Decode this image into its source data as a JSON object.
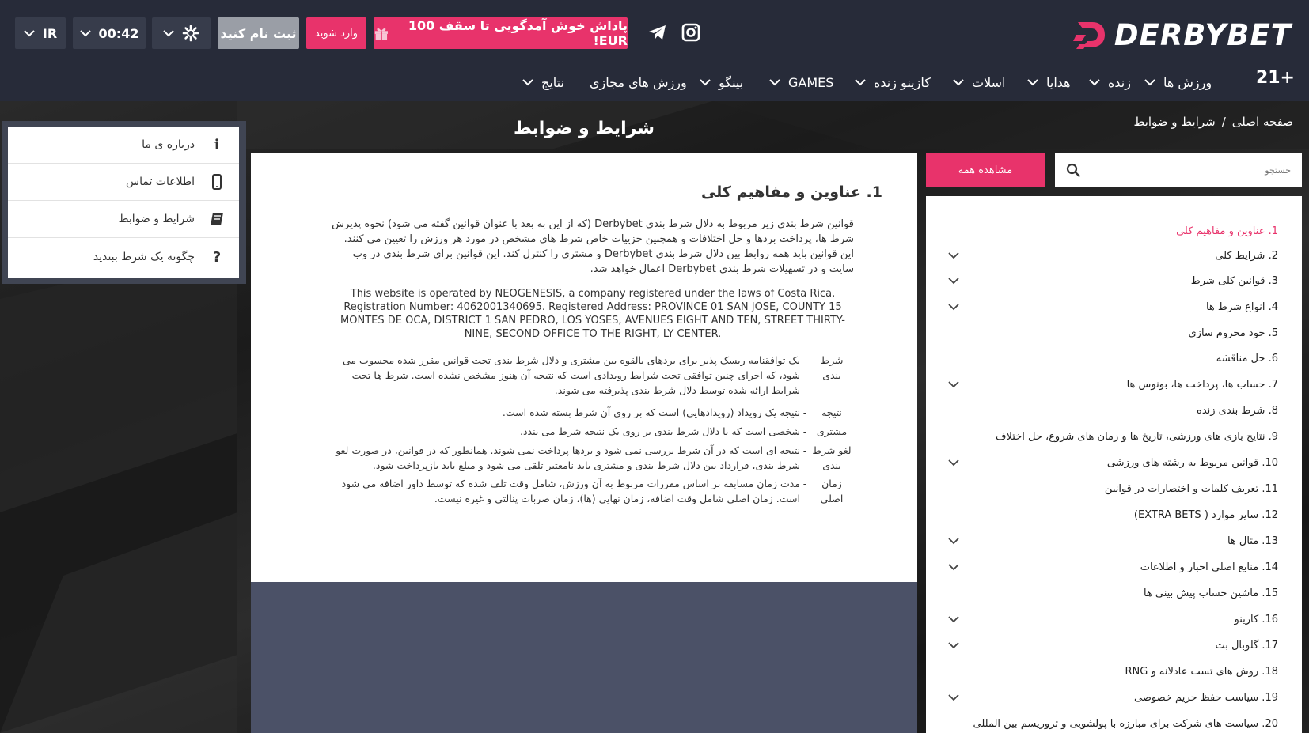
{
  "brand": {
    "name": "DERBYBET",
    "accent": "#e8336b",
    "header_bg": "#272b39"
  },
  "header": {
    "bonus_label": "پاداش خوش آمدگویی تا سقف 100 EUR!",
    "login_label": "وارد شوید",
    "register_label": "ثبت نام کنید",
    "time": "00:42",
    "language": "IR",
    "age_badge": "21+",
    "social_icons": [
      "instagram-icon",
      "telegram-icon"
    ]
  },
  "nav": {
    "items": [
      {
        "label": "ورزش ها"
      },
      {
        "label": "زنده"
      },
      {
        "label": "هدایا"
      },
      {
        "label": "اسلات"
      },
      {
        "label": "کازینو زنده"
      },
      {
        "label": "GAMES"
      },
      {
        "label": "بینگو"
      },
      {
        "label": "ورزش های مجازی"
      },
      {
        "label": "نتایج"
      }
    ]
  },
  "breadcrumb": {
    "home": "صفحه اصلی",
    "separator": "/",
    "current": "شرایط و ضوابط"
  },
  "page_title": "شرایط و ضوابط",
  "info_panel": {
    "items": [
      {
        "label": "درباره ی ما",
        "icon": "info-icon"
      },
      {
        "label": "اطلاعات تماس",
        "icon": "phone-icon"
      },
      {
        "label": "شرایط و ضوابط",
        "icon": "book-icon"
      },
      {
        "label": "چگونه یک شرط ببندید",
        "icon": "question-icon"
      }
    ]
  },
  "document": {
    "heading": "1. عناوین و مفاهیم کلی",
    "para1": "قوانین شرط بندی زیر مربوط به دلال شرط بندی Derbybet (که از این به بعد با عنوان قوانین گفته می شود) نحوه پذیرش شرط ها، پرداخت بردها و حل اختلافات و همچنین جزییات خاص شرط های مشخص در مورد هر ورزش را تعیین می کنند. این قوانین باید همه روابط بین دلال شرط بندی Derbybet و مشتری را کنترل کند. این قوانین برای شرط بندی در وب سایت و در تسهیلات شرط بندی Derbybet اعمال خواهد شد.",
    "para2": "This website is operated by NEOGENESIS, a company registered under the laws of Costa Rica. Registration Number: 4062001340695. Registered Address: PROVINCE 01 SAN JOSE, COUNTY 15 MONTES DE OCA, DISTRICT 1 SAN PEDRO, LOS YOSES, AVENUES EIGHT AND TEN, STREET THIRTY-NINE, SECOND OFFICE TO THE RIGHT, LY CENTER.",
    "definitions": [
      {
        "term": "شرط بندی",
        "text": "یک توافقنامه ریسک پذیر برای بردهای بالقوه بین مشتری و دلال شرط بندی تحت قوانین مقرر شده محسوب می شود، که اجرای چنین توافقی تحت شرایط رویدادی است که نتیجه آن هنوز مشخص نشده است. شرط ها تحت شرایط ارائه شده توسط دلال شرط بندی پذیرفته می شوند."
      },
      {
        "term": "نتیجه",
        "text": "نتیجه یک رویداد (رویدادهایی) است که بر روی آن شرط بسته شده است."
      },
      {
        "term": "مشتری",
        "text": "شخصی است که با دلال شرط بندی بر روی یک نتیجه شرط می بندد."
      },
      {
        "term": "لغو شرط بندی",
        "text": "نتیجه ای است که در آن شرط بررسی نمی شود و بردها پرداخت نمی شوند. همانطور که در قوانین، در صورت لغو شرط بندی، قرارداد بین دلال شرط بندی و مشتری باید نامعتبر تلقی می شود و مبلغ باید بازپرداخت شود."
      },
      {
        "term": "زمان اصلی",
        "text": "مدت زمان مسابقه بر اساس مقررات مربوط به آن ورزش، شامل وقت تلف شده که توسط داور اضافه می شود است. زمان اصلی شامل وقت اضافه، زمان نهایی (ها)، زمان ضربات پنالتی و غیره نیست."
      }
    ]
  },
  "sidebar": {
    "search_placeholder": "جستجو",
    "view_all_label": "مشاهده همه",
    "toc": [
      {
        "label": "1. عناوین و مفاهیم کلی",
        "active": true,
        "expandable": false
      },
      {
        "label": "2. شرایط کلی",
        "active": false,
        "expandable": true
      },
      {
        "label": "3. قوانین کلی شرط",
        "active": false,
        "expandable": true
      },
      {
        "label": "4. انواع شرط ها",
        "active": false,
        "expandable": true
      },
      {
        "label": "5. خود محروم سازی",
        "active": false,
        "expandable": false
      },
      {
        "label": "6. حل مناقشه",
        "active": false,
        "expandable": false
      },
      {
        "label": "7. حساب ها، پرداخت ها، بونوس ها",
        "active": false,
        "expandable": true
      },
      {
        "label": "8. شرط بندی زنده",
        "active": false,
        "expandable": false
      },
      {
        "label": "9. نتایج بازی های ورزشی، تاریخ ها و زمان های شروع، حل اختلاف",
        "active": false,
        "expandable": false
      },
      {
        "label": "10. قوانین مربوط به رشته های ورزشی",
        "active": false,
        "expandable": true
      },
      {
        "label": "11. تعریف کلمات و اختصارات در قوانین",
        "active": false,
        "expandable": false
      },
      {
        "label": "12. سایر موارد ( EXTRA BETS)",
        "active": false,
        "expandable": false
      },
      {
        "label": "13. مثال ها",
        "active": false,
        "expandable": true
      },
      {
        "label": "14. منابع اصلی اخبار و اطلاعات",
        "active": false,
        "expandable": true
      },
      {
        "label": "15. ماشین حساب پیش بینی ها",
        "active": false,
        "expandable": false
      },
      {
        "label": "16. کازینو",
        "active": false,
        "expandable": true
      },
      {
        "label": "17. گلوبال بت",
        "active": false,
        "expandable": true
      },
      {
        "label": "18. روش های تست عادلانه و RNG",
        "active": false,
        "expandable": false
      },
      {
        "label": "19. سیاست حفظ حریم خصوصی",
        "active": false,
        "expandable": true
      },
      {
        "label": "20. سیاست های شرکت برای مبارزه با پولشویی و تروریسم بین المللی",
        "active": false,
        "expandable": false
      }
    ]
  }
}
